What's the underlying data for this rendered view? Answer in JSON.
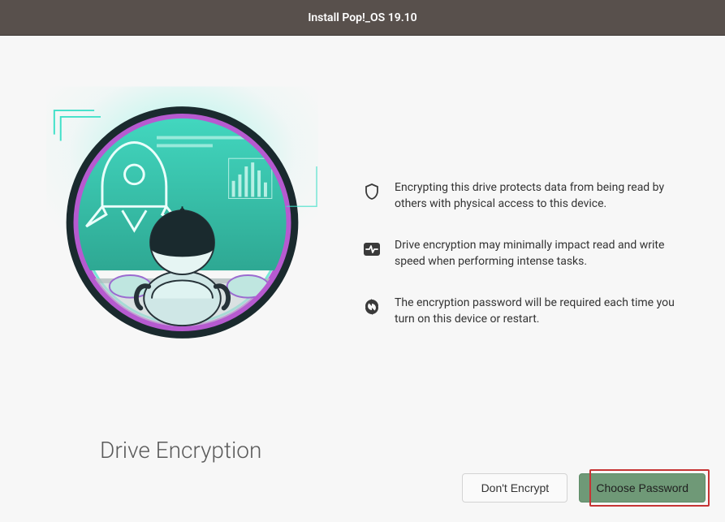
{
  "titlebar": {
    "text": "Install Pop!_OS 19.10"
  },
  "page": {
    "title": "Drive Encryption"
  },
  "info": [
    {
      "icon": "shield-icon",
      "text": "Encrypting this drive protects data from being read by others with physical access to this device."
    },
    {
      "icon": "activity-icon",
      "text": "Drive encryption may minimally impact read and write speed when performing intense tasks."
    },
    {
      "icon": "refresh-icon",
      "text": "The encryption password will be required each time you turn on this device or restart."
    }
  ],
  "buttons": {
    "secondary": "Don't Encrypt",
    "primary": "Choose Password"
  }
}
